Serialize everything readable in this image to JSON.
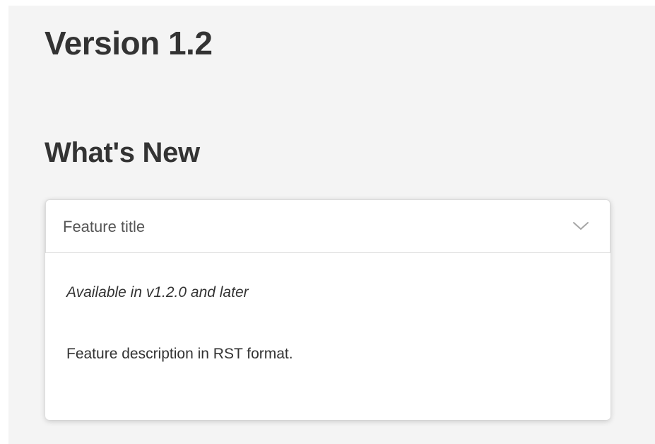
{
  "page": {
    "version_title": "Version 1.2",
    "section_title": "What's New"
  },
  "feature": {
    "title": "Feature title",
    "availability": "Available in v1.2.0 and later",
    "description": "Feature description in RST format.",
    "expanded": true
  },
  "icons": {
    "toggle": "chevron-down-icon"
  },
  "colors": {
    "panel_background": "#f4f4f4",
    "card_background": "#ffffff",
    "heading_text": "#333333",
    "header_text": "#555555",
    "chevron": "#a6a6a6"
  }
}
